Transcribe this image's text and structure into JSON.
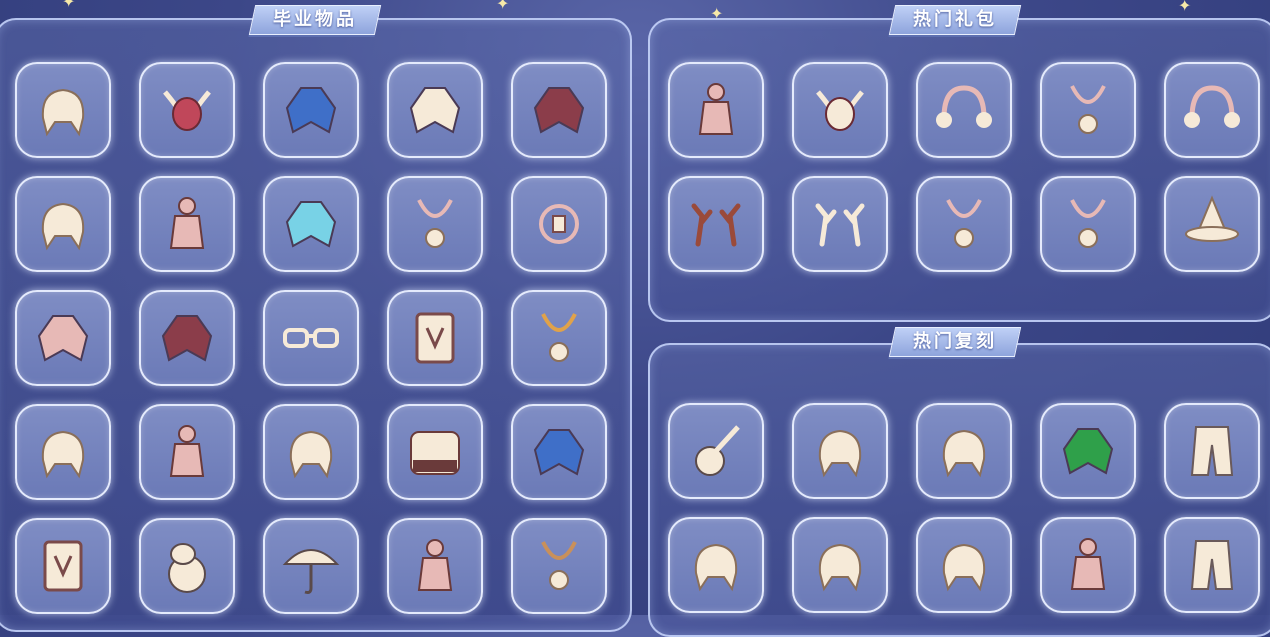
{
  "sections": {
    "graduation": {
      "title": "毕业物品"
    },
    "hot_gifts": {
      "title": "热门礼包"
    },
    "hot_reruns": {
      "title": "热门复刻"
    }
  },
  "colors": {
    "background": "#3c4788",
    "slot_fill": "#7380bd",
    "panel_border": "#cddaff",
    "ribbon": "#9fb4e6",
    "accent_star": "#f7e9a8"
  },
  "graduation_items": [
    "hair-ears-icon",
    "horned-mask-icon",
    "blue-cape-icon",
    "white-cape-icon",
    "dark-layered-cape-icon",
    "white-hair-icon",
    "pink-outfit-icon",
    "butterfly-cape-icon",
    "orange-scarf-icon",
    "ornate-accessory-icon",
    "shell-cape-icon",
    "red-cape-icon",
    "glasses-icon",
    "lantern-prop-icon",
    "golden-ribbon-icon",
    "feather-hair-icon",
    "pink-dress-icon",
    "bun-hair-icon",
    "piano-prop-icon",
    "blue-cape-2-icon",
    "card-prop-icon",
    "moomin-prop-icon",
    "umbrella-prop-icon",
    "pink-coat-icon",
    "brown-scarf-icon"
  ],
  "gift_items": [
    "pink-outfit-2-icon",
    "cloud-mask-icon",
    "moon-headband-icon",
    "pendant-necklace-icon",
    "earmuffs-icon",
    "antlers-red-icon",
    "antlers-cream-icon",
    "bow-necklace-icon",
    "jellyfish-necklace-icon",
    "witch-hat-icon"
  ],
  "rerun_items": [
    "ukulele-prop-icon",
    "twin-buns-hair-icon",
    "ponytail-hair-icon",
    "green-cape-icon",
    "white-pants-icon",
    "long-wavy-hair-icon",
    "short-hair-icon",
    "cat-ears-hair-icon",
    "white-outfit-icon",
    "cargo-pants-icon"
  ]
}
